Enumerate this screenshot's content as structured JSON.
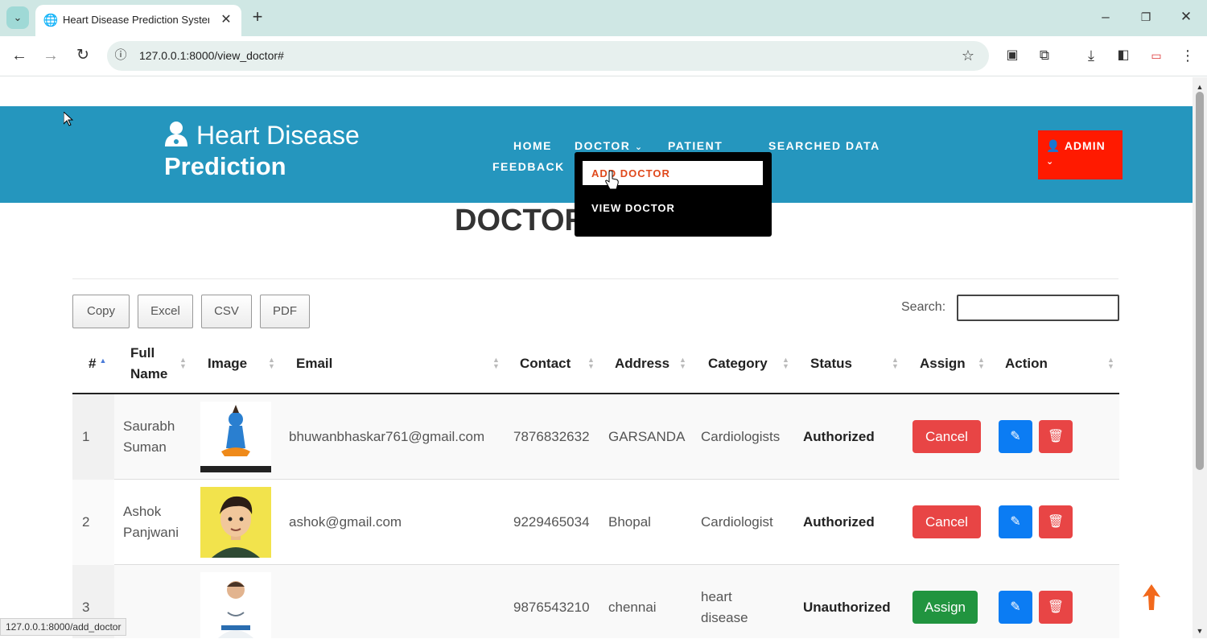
{
  "browser": {
    "tab_title": "Heart Disease Prediction System",
    "url": "127.0.0.1:8000/view_doctor#",
    "status_url": "127.0.0.1:8000/add_doctor"
  },
  "brand": {
    "line1": "Heart Disease",
    "line2": "Prediction"
  },
  "nav": {
    "home": "HOME",
    "doctor": "DOCTOR",
    "patient": "PATIENT",
    "searched": "SEARCHED DATA",
    "feedback": "FEEDBACK",
    "admin": "ADMIN"
  },
  "dropdown": {
    "add": "ADD DOCTOR",
    "view": "VIEW DOCTOR"
  },
  "page_title": "DOCTOR",
  "export_buttons": [
    "Copy",
    "Excel",
    "CSV",
    "PDF"
  ],
  "search": {
    "label": "Search:",
    "value": ""
  },
  "table": {
    "headers": [
      "#",
      "Full Name",
      "Image",
      "Email",
      "Contact",
      "Address",
      "Category",
      "Status",
      "Assign",
      "Action"
    ],
    "rows": [
      {
        "num": "1",
        "name": "Saurabh Suman",
        "email": "bhuwanbhaskar761@gmail.com",
        "contact": "7876832632",
        "address": "GARSANDA",
        "category": "Cardiologists",
        "status": "Authorized",
        "assign": "Cancel",
        "assign_color": "#e84545"
      },
      {
        "num": "2",
        "name": "Ashok Panjwani",
        "email": "ashok@gmail.com",
        "contact": "9229465034",
        "address": "Bhopal",
        "category": "Cardiologist",
        "status": "Authorized",
        "assign": "Cancel",
        "assign_color": "#e84545"
      },
      {
        "num": "3",
        "name": "",
        "email": "",
        "contact": "9876543210",
        "address": "chennai",
        "category": "heart disease",
        "status": "Unauthorized",
        "assign": "Assign",
        "assign_color": "#21943f"
      }
    ]
  },
  "colors": {
    "header": "#2596be",
    "admin": "#ff1a00",
    "accent": "#e0491c"
  }
}
